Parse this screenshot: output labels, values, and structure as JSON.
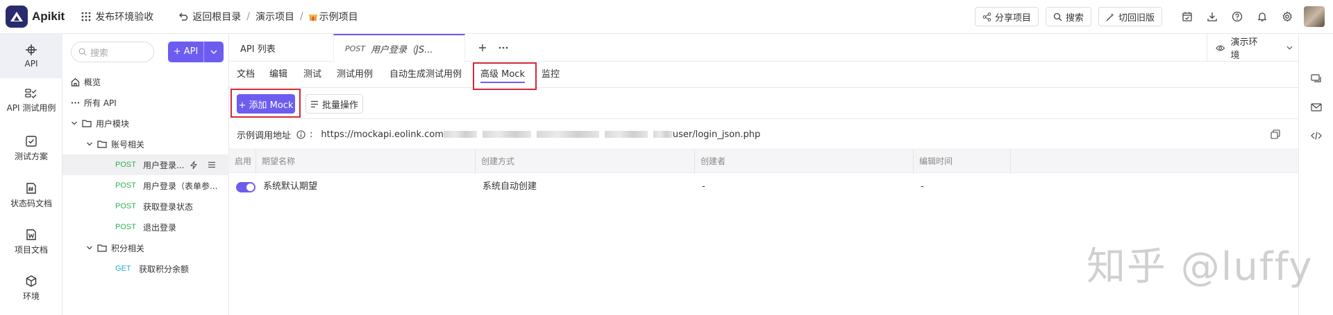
{
  "app": {
    "name": "Apikit"
  },
  "topbar": {
    "publish_label": "发布环境验收",
    "back_label": "返回根目录",
    "breadcrumb": [
      "演示项目",
      "示例项目"
    ],
    "share_label": "分享项目",
    "search_label": "搜索",
    "switch_label": "切回旧版"
  },
  "rail": {
    "items": [
      {
        "label": "API",
        "icon": "api-icon"
      },
      {
        "label": "API 测试用例",
        "icon": "test-case-icon"
      },
      {
        "label": "测试方案",
        "icon": "test-plan-icon"
      },
      {
        "label": "状态码文档",
        "icon": "status-code-icon"
      },
      {
        "label": "项目文档",
        "icon": "project-doc-icon"
      },
      {
        "label": "环境",
        "icon": "environment-icon"
      }
    ]
  },
  "tree": {
    "search_placeholder": "搜索",
    "add_api_label": "+ API",
    "overview": "概览",
    "all_api": "所有 API",
    "user_module": "用户模块",
    "account_group": "账号相关",
    "points_group": "积分相关",
    "apis": [
      {
        "method": "POST",
        "name": "用户登录..."
      },
      {
        "method": "POST",
        "name": "用户登录（表单参..."
      },
      {
        "method": "POST",
        "name": "获取登录状态"
      },
      {
        "method": "POST",
        "name": "退出登录"
      },
      {
        "method": "GET",
        "name": "获取积分余额"
      }
    ]
  },
  "tabs": {
    "api_list": "API 列表",
    "active_method": "POST",
    "active_title": "用户登录（JS...",
    "env_label": "演示环境"
  },
  "subtabs": [
    "文档",
    "编辑",
    "测试",
    "测试用例",
    "自动生成测试用例",
    "高级 Mock",
    "监控"
  ],
  "toolbar": {
    "add_mock": "+ 添加 Mock",
    "batch": "批量操作"
  },
  "url": {
    "label": "示例调用地址",
    "prefix": "https://mockapi.eolink.com",
    "suffix": "user/login_json.php"
  },
  "table": {
    "headers": [
      "启用",
      "期望名称",
      "创建方式",
      "创建者",
      "编辑时间"
    ],
    "rows": [
      {
        "enabled": true,
        "name": "系统默认期望",
        "method": "系统自动创建",
        "creator": "-",
        "edited": "-"
      }
    ]
  },
  "watermark": "知乎 @luffy",
  "colors": {
    "accent": "#6d5cf0",
    "highlight": "#d0283b",
    "post": "#2bb24c",
    "get": "#2aa8c9"
  }
}
